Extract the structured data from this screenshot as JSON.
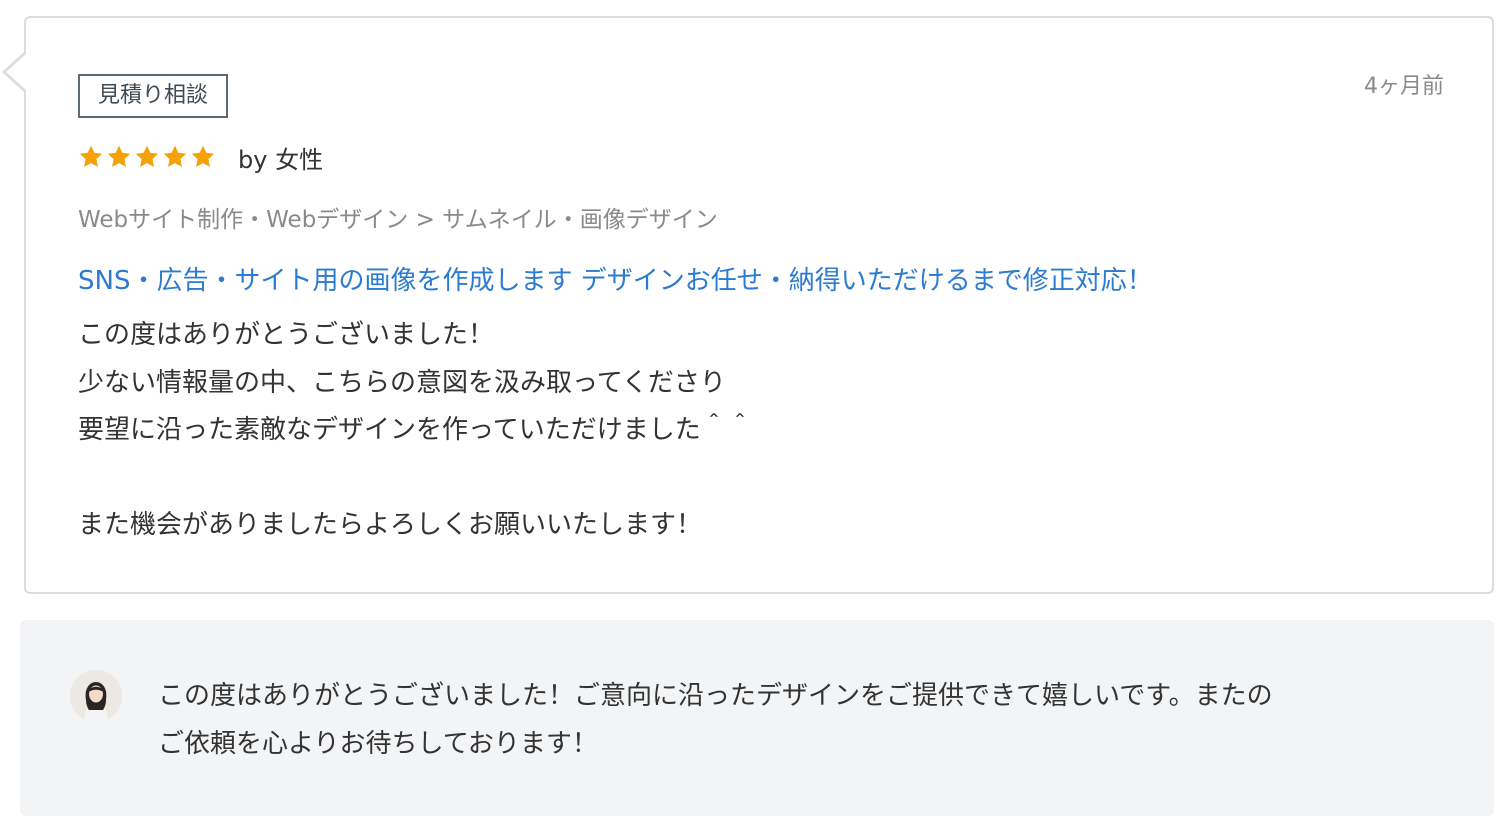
{
  "review": {
    "tag": "見積り相談",
    "time": "4ヶ月前",
    "rating": 5,
    "star_color": "#f5a20a",
    "by": "by 女性",
    "category": "Webサイト制作・Webデザイン > サムネイル・画像デザイン",
    "service_title": "SNS・広告・サイト用の画像を作成します デザインお任せ・納得いただけるまで修正対応！",
    "comment_lines": [
      "この度はありがとうございました！",
      "少ない情報量の中、こちらの意図を汲み取ってくださり",
      "要望に沿った素敵なデザインを作っていただけました＾＾",
      "",
      "また機会がありましたらよろしくお願いいたします！"
    ]
  },
  "reply": {
    "avatar_icon": "seller-avatar",
    "lines": [
      "この度はありがとうございました！ご意向に沿ったデザインをご提供できて嬉しいです。またの",
      "ご依頼を心よりお待ちしております！"
    ]
  },
  "colors": {
    "link": "#2a7bd1",
    "star": "#f5a20a",
    "reply_bg": "#f3f4f6"
  }
}
